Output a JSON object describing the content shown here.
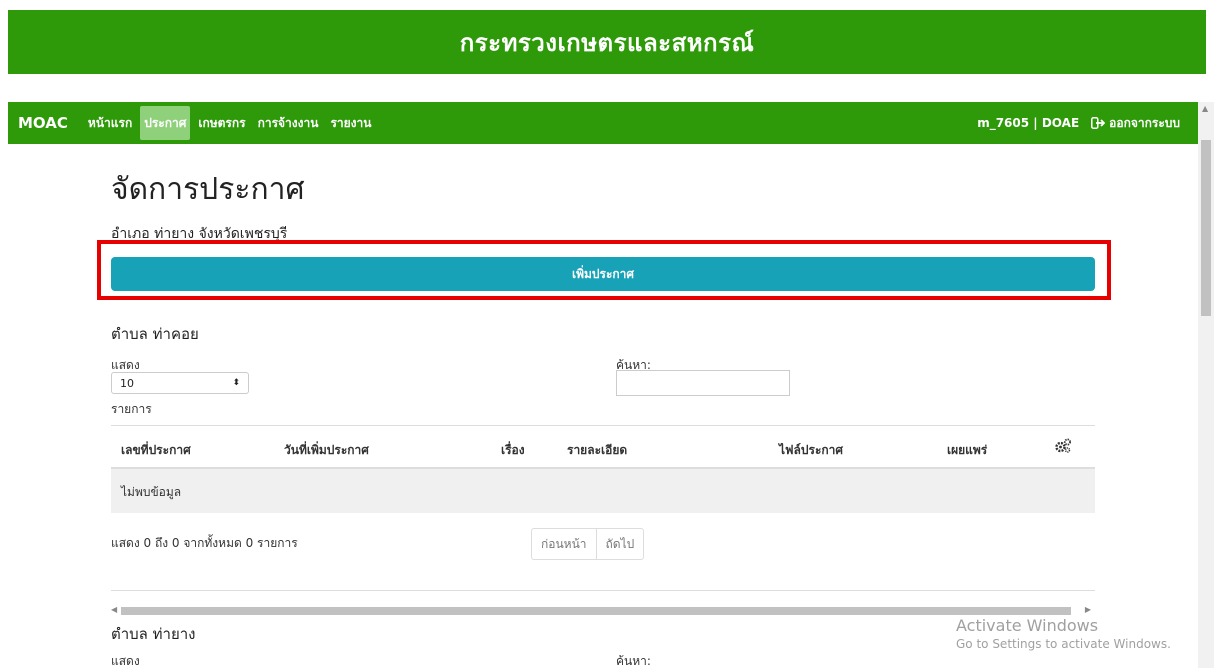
{
  "banner": {
    "title": "กระทรวงเกษตรและสหกรณ์"
  },
  "navbar": {
    "brand": "MOAC",
    "items": [
      {
        "label": "หน้าแรก"
      },
      {
        "label": "ประกาศ"
      },
      {
        "label": "เกษตรกร"
      },
      {
        "label": "การจ้างงาน"
      },
      {
        "label": "รายงาน"
      }
    ],
    "user": "m_7605 | DOAE",
    "logout": "ออกจากระบบ"
  },
  "page": {
    "title": "จัดการประกาศ",
    "subtitle": "อำเภอ ท่ายาง จังหวัดเพชรบุรี",
    "add_button": "เพิ่มประกาศ"
  },
  "sections": [
    {
      "title": "ตำบล ท่าคอย",
      "show_label": "แสดง",
      "show_value": "10",
      "entries_label": "รายการ",
      "search_label": "ค้นหา:",
      "search_value": "",
      "columns": [
        "เลขที่ประกาศ",
        "วันที่เพิ่มประกาศ",
        "เรื่อง",
        "รายละเอียด",
        "ไฟล์ประกาศ",
        "เผยแพร่"
      ],
      "empty_text": "ไม่พบข้อมูล",
      "info": "แสดง 0 ถึง 0 จากทั้งหมด 0 รายการ",
      "prev": "ก่อนหน้า",
      "next": "ถัดไป"
    },
    {
      "title": "ตำบล ท่ายาง",
      "show_label": "แสดง",
      "search_label": "ค้นหา:"
    }
  ],
  "watermark": {
    "line1": "Activate Windows",
    "line2": "Go to Settings to activate Windows."
  },
  "colors": {
    "primary_green": "#2e9a0a",
    "active_nav": "#8fd17a",
    "add_button": "#17a2b8",
    "highlight": "#e60000"
  }
}
